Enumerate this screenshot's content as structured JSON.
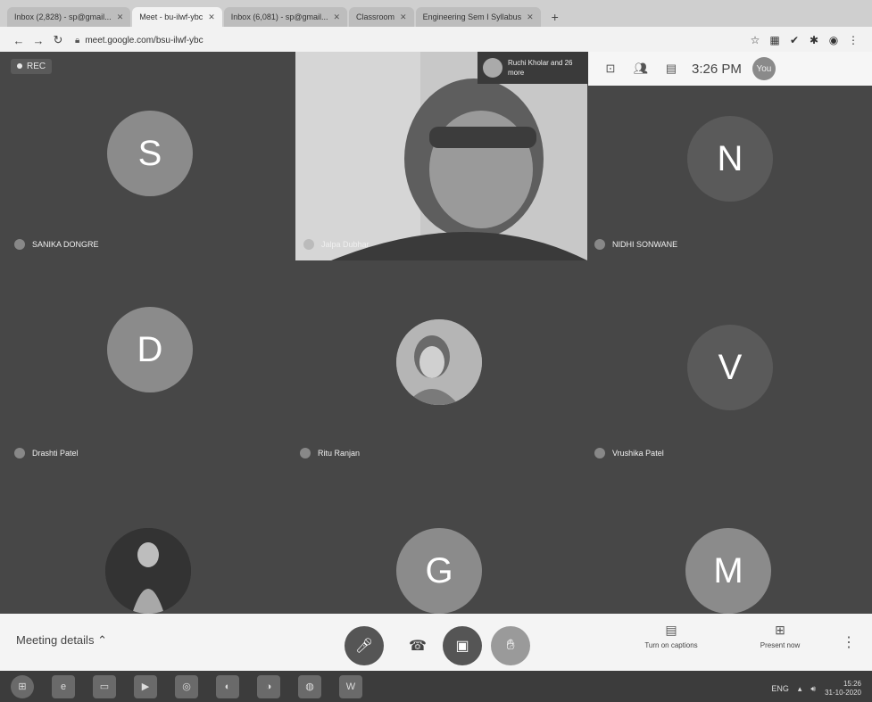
{
  "browser": {
    "tabs": [
      {
        "title": "Inbox (2,828) - sp@gmail...",
        "active": false
      },
      {
        "title": "Meet - bu-ilwf-ybc",
        "active": true
      },
      {
        "title": "Inbox (6,081) - sp@gmail...",
        "active": false
      },
      {
        "title": "Classroom",
        "active": false
      },
      {
        "title": "Engineering Sem I Syllabus",
        "active": false
      }
    ],
    "url": "meet.google.com/bsu-ilwf-ybc"
  },
  "meeting": {
    "rec_label": "REC",
    "presenter_info": "Ruchi Kholar and 26 more",
    "time": "3:26 PM",
    "user_initial": "You",
    "participants": [
      {
        "initial": "S",
        "name": "SANIKA DONGRE",
        "color": "#8b8b8b"
      },
      {
        "initial": "",
        "name": "Jalpa Dubhar",
        "color": ""
      },
      {
        "initial": "N",
        "name": "NIDHI SONWANE",
        "color": "#5a5a5a"
      },
      {
        "initial": "D",
        "name": "Drashti Patel",
        "color": "#8b8b8b"
      },
      {
        "initial": "",
        "name": "Ritu Ranjan",
        "color": ""
      },
      {
        "initial": "V",
        "name": "Vrushika Patel",
        "color": "#5a5a5a"
      },
      {
        "initial": "",
        "name": "",
        "color": ""
      },
      {
        "initial": "G",
        "name": "",
        "color": "#8b8b8b"
      },
      {
        "initial": "M",
        "name": "",
        "color": "#8b8b8b"
      }
    ]
  },
  "controls": {
    "meeting_details": "Meeting details",
    "captions_label": "Turn on captions",
    "present_label": "Present now"
  },
  "taskbar": {
    "lang": "ENG",
    "time": "15:26",
    "date": "31-10-2020"
  }
}
